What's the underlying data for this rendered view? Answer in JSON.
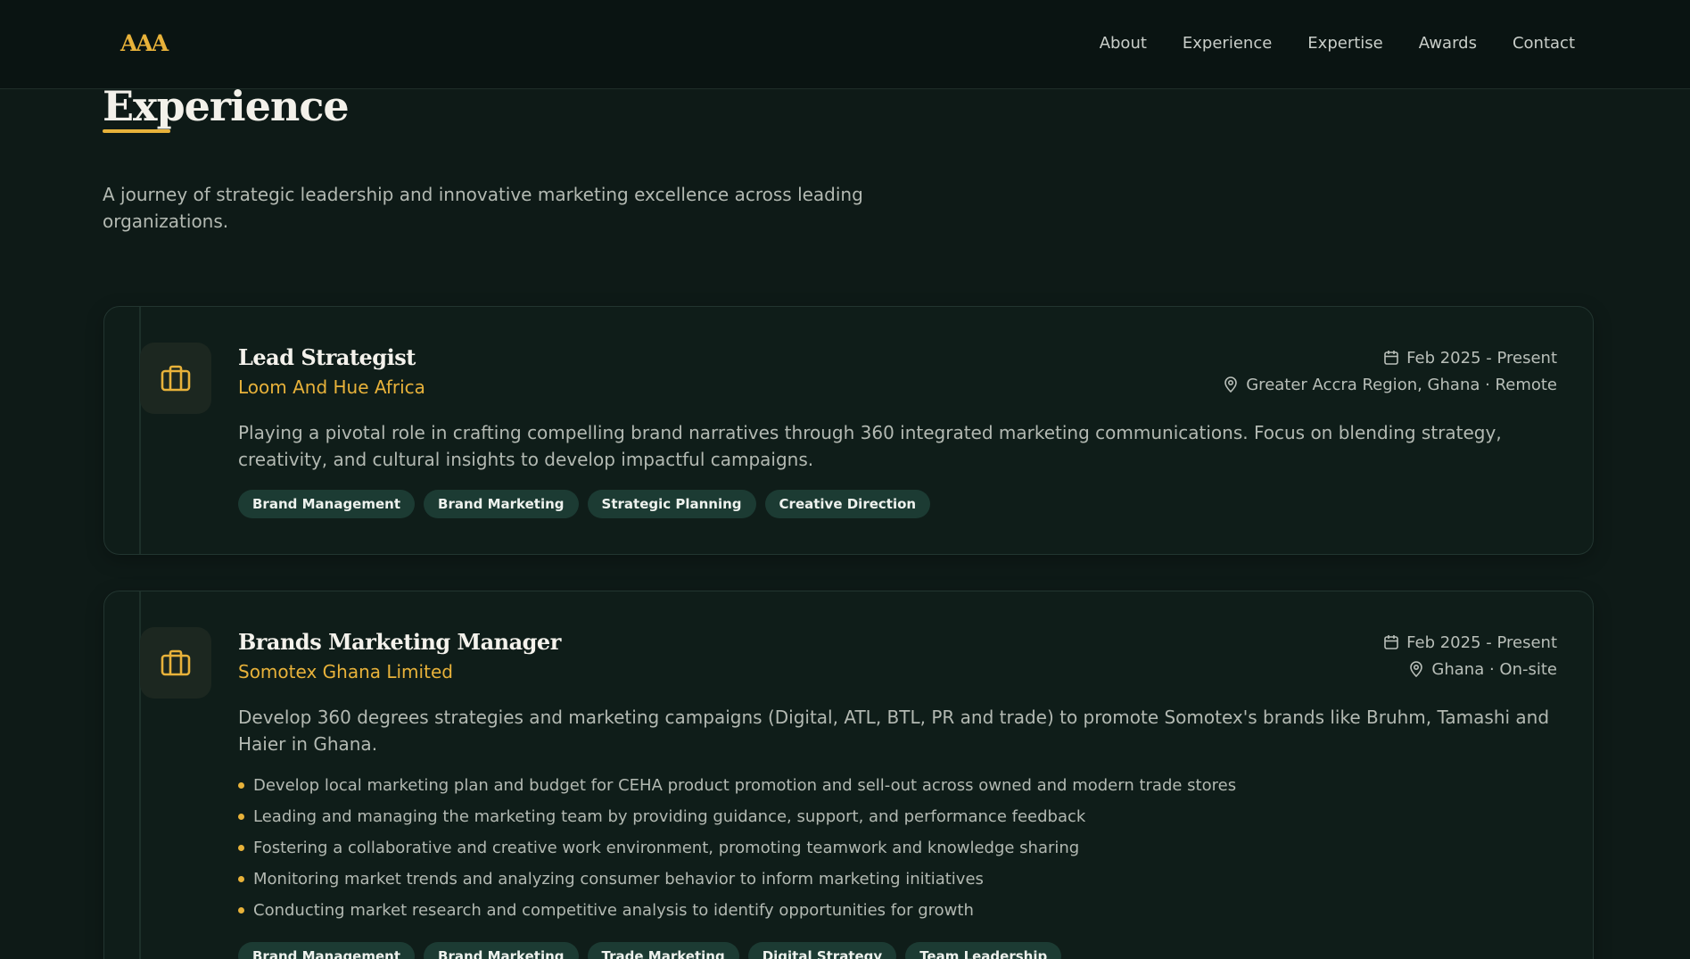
{
  "brand": {
    "logo": "AAA",
    "accent": "#e8b23a"
  },
  "nav": {
    "items": [
      {
        "label": "About"
      },
      {
        "label": "Experience"
      },
      {
        "label": "Expertise"
      },
      {
        "label": "Awards"
      },
      {
        "label": "Contact"
      }
    ]
  },
  "header": {
    "title": "Experience",
    "subtitle": "A journey of strategic leadership and innovative marketing excellence across leading organizations."
  },
  "experiences": [
    {
      "icon": "briefcase-icon",
      "title": "Lead Strategist",
      "company": "Loom And Hue Africa",
      "dates": "Feb 2025 - Present",
      "location": "Greater Accra Region, Ghana · Remote",
      "description": "Playing a pivotal role in crafting compelling brand narratives through 360 integrated marketing communications. Focus on blending strategy, creativity, and cultural insights to develop impactful campaigns.",
      "bullets": [],
      "tags": [
        "Brand Management",
        "Brand Marketing",
        "Strategic Planning",
        "Creative Direction"
      ]
    },
    {
      "icon": "briefcase-icon",
      "title": "Brands Marketing Manager",
      "company": "Somotex Ghana Limited",
      "dates": "Feb 2025 - Present",
      "location": "Ghana · On-site",
      "description": "Develop 360 degrees strategies and marketing campaigns (Digital, ATL, BTL, PR and trade) to promote Somotex's brands like Bruhm, Tamashi and Haier in Ghana.",
      "bullets": [
        "Develop local marketing plan and budget for CEHA product promotion and sell-out across owned and modern trade stores",
        "Leading and managing the marketing team by providing guidance, support, and performance feedback",
        "Fostering a collaborative and creative work environment, promoting teamwork and knowledge sharing",
        "Monitoring market trends and analyzing consumer behavior to inform marketing initiatives",
        "Conducting market research and competitive analysis to identify opportunities for growth"
      ],
      "tags": [
        "Brand Management",
        "Brand Marketing",
        "Trade Marketing",
        "Digital Strategy",
        "Team Leadership"
      ]
    }
  ]
}
